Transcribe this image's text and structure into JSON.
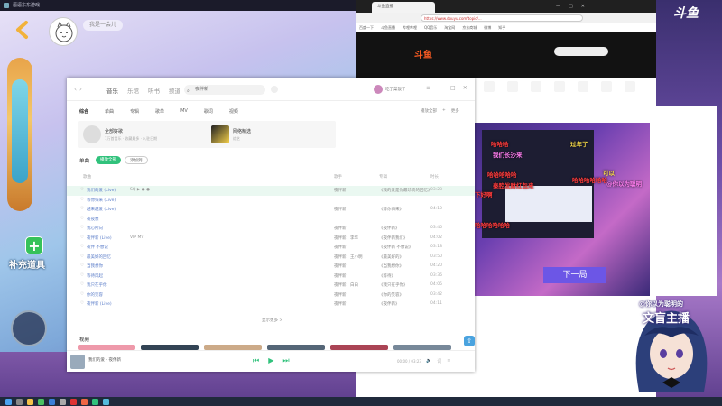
{
  "game": {
    "window_title": "逗逗东东游戏",
    "player_name": "我是一会儿",
    "supply_label": "补充道具"
  },
  "music": {
    "tabs": [
      "音乐",
      "乐馆",
      "听书",
      "频道"
    ],
    "active_tab": 0,
    "search_value": "夜伴新",
    "user_name": "吃了菜饭了",
    "subtabs": [
      "综合",
      "单曲",
      "专辑",
      "歌单",
      "MV",
      "歌词",
      "视频"
    ],
    "subtab_right": [
      "播放全部",
      "+",
      "更多"
    ],
    "card1": {
      "title": "全部好歌",
      "sub": "1万首音乐 · 收藏最多 · 入驻日期"
    },
    "card2": {
      "title": "网络精选",
      "sub": "综艺"
    },
    "section_title": "单曲",
    "play_all": "播放全部",
    "add_to": "添加到",
    "columns": [
      "歌曲",
      "歌手",
      "专辑",
      "时长"
    ],
    "songs": [
      {
        "title": "我们的爱 (Live)",
        "tags": "SQ ▶ ● ●",
        "artist": "夜伴新",
        "album": "《我的爱是你最珍贵的回忆》",
        "duration": "03:23"
      },
      {
        "title": "等你归来 (Live)",
        "tags": "",
        "artist": "",
        "album": "",
        "duration": ""
      },
      {
        "title": "越来越爱 (Live)",
        "tags": "",
        "artist": "夜伴新",
        "album": "《等你归来》",
        "duration": "04:10"
      },
      {
        "title": "夜夜想",
        "tags": "",
        "artist": "",
        "album": "",
        "duration": ""
      },
      {
        "title": "我心所向",
        "tags": "",
        "artist": "夜伴新",
        "album": "《夜伴新》",
        "duration": "03:45"
      },
      {
        "title": "夜伴新 (Live)",
        "tags": "VIP MV",
        "artist": "夜伴新、李华",
        "album": "《夜伴新我们》",
        "duration": "04:02"
      },
      {
        "title": "夜伴 不想说",
        "tags": "",
        "artist": "夜伴新",
        "album": "《夜伴新 不想说》",
        "duration": "03:18"
      },
      {
        "title": "最美好的回忆",
        "tags": "",
        "artist": "夜伴新、王小明",
        "album": "《最美好的》",
        "duration": "03:50"
      },
      {
        "title": "当我想你",
        "tags": "",
        "artist": "夜伴新",
        "album": "《当我想你》",
        "duration": "04:20"
      },
      {
        "title": "等待风起",
        "tags": "",
        "artist": "夜伴新",
        "album": "《等待》",
        "duration": "03:36"
      },
      {
        "title": "我只在乎你",
        "tags": "",
        "artist": "夜伴新、白白",
        "album": "《我只在乎你》",
        "duration": "04:05"
      },
      {
        "title": "你的笑容",
        "tags": "",
        "artist": "夜伴新",
        "album": "《你的笑容》",
        "duration": "03:42"
      },
      {
        "title": "夜伴新 (Live)",
        "tags": "",
        "artist": "夜伴新",
        "album": "《夜伴新》",
        "duration": "04:11"
      }
    ],
    "more_label": "显示更多 >",
    "mv_title": "视频",
    "player_title": "我们的爱 - 夜伴新",
    "player_time": "00:00 / 03:23"
  },
  "browser": {
    "tab_title": "斗鱼直播",
    "url": "https://www.douyu.com/topic/...",
    "bookmarks": [
      "百度一下",
      "斗鱼直播",
      "哔哩哔哩",
      "QQ音乐",
      "淘宝网",
      "京东商城",
      "微博",
      "知乎"
    ],
    "logo": "斗鱼",
    "next_button": "下一局"
  },
  "danmaku": [
    {
      "text": "哈哈哈",
      "color": "#ff3b3b"
    },
    {
      "text": "过年了",
      "color": "#ffe14a"
    },
    {
      "text": "我们长沙来",
      "color": "#ff7df0"
    },
    {
      "text": "哈哈哈哈哈",
      "color": "#ff3b3b"
    },
    {
      "text": "哈哈哈哈哈哈",
      "color": "#ff3b3b"
    },
    {
      "text": "可以",
      "color": "#ffe14a"
    },
    {
      "text": "秦腔发财红包来",
      "color": "#ff3b3b"
    },
    {
      "text": "@你以为聪明",
      "color": "#ff7df0"
    },
    {
      "text": "下好啊",
      "color": "#ff3b3b"
    },
    {
      "text": "哈哈哈哈哈哈",
      "color": "#ff3b3b"
    }
  ],
  "overlay": {
    "corner_logo": "斗鱼",
    "line1": "@你以为聪明的",
    "line2": "文盲主播"
  },
  "colors": {
    "accent": "#31c27c",
    "link": "#5c7ec9",
    "douyu": "#ff5d23"
  }
}
